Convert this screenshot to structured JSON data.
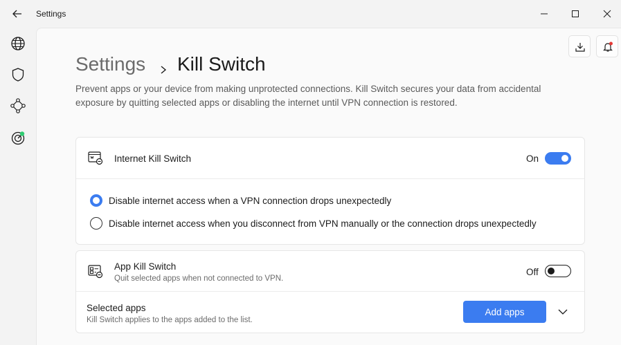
{
  "window": {
    "title": "Settings"
  },
  "breadcrumb": {
    "root": "Settings",
    "separator": "›",
    "current": "Kill Switch"
  },
  "description": "Prevent apps or your device from making unprotected connections. Kill Switch secures your data from accidental exposure by quitting selected apps or disabling the internet until VPN connection is restored.",
  "internet_kill_switch": {
    "title": "Internet Kill Switch",
    "toggle_label": "On",
    "enabled": true,
    "options": [
      {
        "label": "Disable internet access when a VPN connection drops unexpectedly",
        "selected": true
      },
      {
        "label": "Disable internet access when you disconnect from VPN manually or the connection drops unexpectedly",
        "selected": false
      }
    ]
  },
  "app_kill_switch": {
    "title": "App Kill Switch",
    "subtitle": "Quit selected apps when not connected to VPN.",
    "toggle_label": "Off",
    "enabled": false
  },
  "selected_apps": {
    "title": "Selected apps",
    "subtitle": "Kill Switch applies to the apps added to the list.",
    "add_button": "Add apps"
  },
  "colors": {
    "accent": "#3b7cf0",
    "notification_dot": "#e53935",
    "status_dot": "#2ecc71"
  },
  "icons": {
    "rail": [
      "globe-icon",
      "shield-icon",
      "meshnet-icon",
      "threat-protection-icon"
    ],
    "top": [
      "download-icon",
      "bell-icon"
    ]
  }
}
